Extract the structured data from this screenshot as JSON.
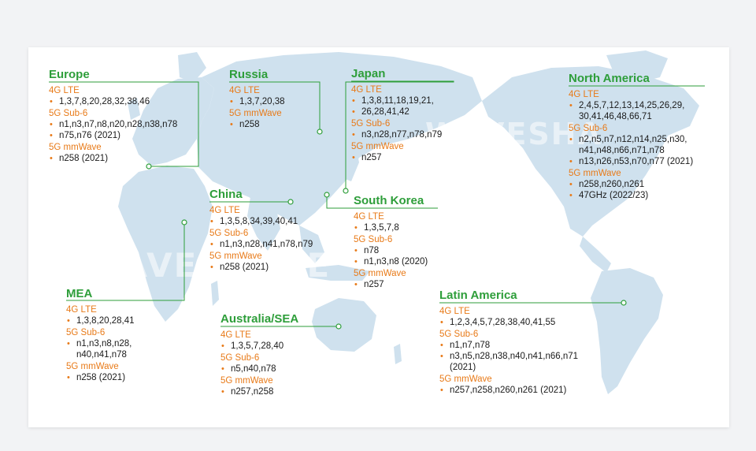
{
  "regions": {
    "europe": {
      "title": "Europe",
      "lte_label": "4G LTE",
      "lte": [
        "1,3,7,8,20,28,32,38,46"
      ],
      "sub6_label": "5G Sub-6",
      "sub6": [
        "n1,n3,n7,n8,n20,n28,n38,n78",
        "n75,n76 (2021)"
      ],
      "mm_label": "5G mmWave",
      "mm": [
        "n258 (2021)"
      ]
    },
    "russia": {
      "title": "Russia",
      "lte_label": "4G LTE",
      "lte": [
        "1,3,7,20,38"
      ],
      "mm_label": "5G mmWave",
      "mm": [
        "n258"
      ]
    },
    "japan": {
      "title": "Japan",
      "lte_label": "4G LTE",
      "lte": [
        "1,3,8,11,18,19,21,",
        "26,28,41,42"
      ],
      "sub6_label": "5G Sub-6",
      "sub6": [
        "n3,n28,n77,n78,n79"
      ],
      "mm_label": "5G mmWave",
      "mm": [
        "n257"
      ]
    },
    "north_america": {
      "title": "North America",
      "lte_label": "4G LTE",
      "lte": [
        "2,4,5,7,12,13,14,25,26,29,",
        "30,41,46,48,66,71"
      ],
      "sub6_label": "5G Sub-6",
      "sub6": [
        "n2,n5,n7,n12,n14,n25,n30,",
        "n41,n48,n66,n71,n78",
        "n13,n26,n53,n70,n77 (2021)"
      ],
      "mm_label": "5G mmWave",
      "mm": [
        "n258,n260,n261",
        "47GHz (2022/23)"
      ]
    },
    "china": {
      "title": "China",
      "lte_label": "4G LTE",
      "lte": [
        "1,3,5,8,34,39,40,41"
      ],
      "sub6_label": "5G Sub-6",
      "sub6": [
        "n1,n3,n28,n41,n78,n79"
      ],
      "mm_label": "5G mmWave",
      "mm": [
        "n258 (2021)"
      ]
    },
    "south_korea": {
      "title": "South Korea",
      "lte_label": "4G LTE",
      "lte": [
        "1,3,5,7,8"
      ],
      "sub6_label": "5G Sub-6",
      "sub6": [
        "n78",
        "n1,n3,n8 (2020)"
      ],
      "mm_label": "5G mmWave",
      "mm": [
        "n257"
      ]
    },
    "mea": {
      "title": "MEA",
      "lte_label": "4G LTE",
      "lte": [
        "1,3,8,20,28,41"
      ],
      "sub6_label": "5G Sub-6",
      "sub6": [
        "n1,n3,n8,n28,",
        "n40,n41,n78"
      ],
      "mm_label": "5G mmWave",
      "mm": [
        "n258 (2021)"
      ]
    },
    "australia_sea": {
      "title": "Australia/SEA",
      "lte_label": "4G LTE",
      "lte": [
        "1,3,5,7,28,40"
      ],
      "sub6_label": "5G Sub-6",
      "sub6": [
        "n5,n40,n78"
      ],
      "mm_label": "5G mmWave",
      "mm": [
        "n257,n258"
      ]
    },
    "latin_america": {
      "title": "Latin America",
      "lte_label": "4G LTE",
      "lte": [
        "1,2,3,4,5,7,28,38,40,41,55"
      ],
      "sub6_label": "5G Sub-6",
      "sub6": [
        "n1,n7,n78",
        "n3,n5,n28,n38,n40,n41,n66,n71",
        "(2021)"
      ],
      "mm_label": "5G mmWave",
      "mm": [
        "n257,n258,n260,n261 (2021)"
      ]
    }
  },
  "watermark": {
    "text_1": "WAVESHARE",
    "text_2": "WAVESHA"
  },
  "colors": {
    "title": "#2e9e3a",
    "category": "#e87a18",
    "land": "#cfe1ee",
    "line": "#2e9e3a"
  }
}
